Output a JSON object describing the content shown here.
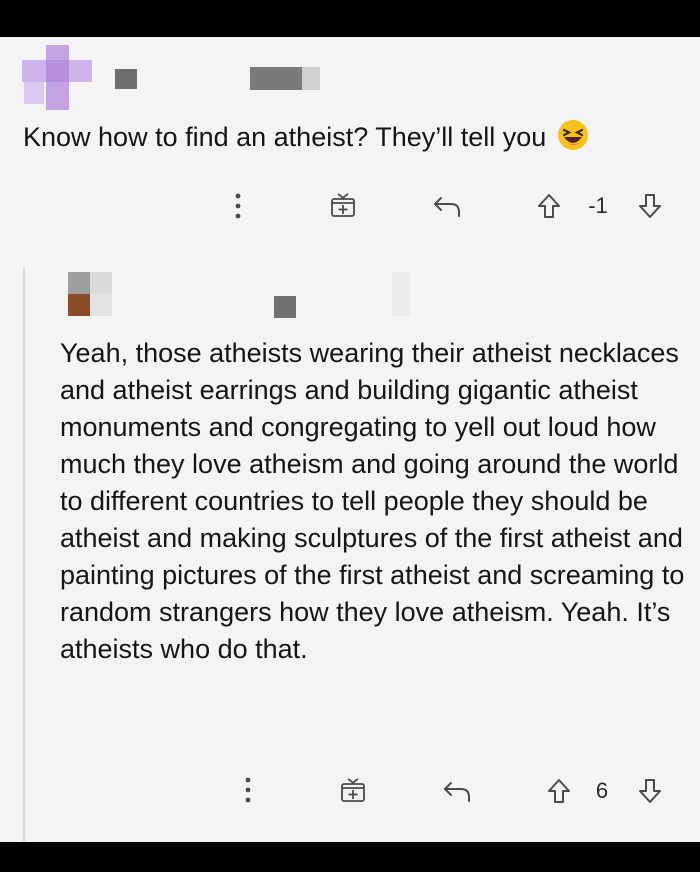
{
  "comment_1": {
    "text": "Know how to find an atheist? They’ll tell you",
    "emoji_icon": "laughing-face-icon",
    "actions": {
      "more_icon": "more-vertical-icon",
      "award_icon": "gift-icon",
      "reply_icon": "reply-arrow-icon",
      "upvote_icon": "arrow-up-icon",
      "vote_count": "-1",
      "downvote_icon": "arrow-down-icon"
    }
  },
  "comment_2": {
    "text": "Yeah, those atheists wearing their atheist necklaces and atheist earrings and building gigantic atheist monuments and congregating to yell out loud how much they love atheism and going around the world to different countries to tell people they should be atheist and making sculptures of the first atheist and painting pictures of the first atheist and screaming to random strangers how they love atheism. Yeah. It’s atheists who do that.",
    "actions": {
      "more_icon": "more-vertical-icon",
      "award_icon": "gift-icon",
      "reply_icon": "reply-arrow-icon",
      "upvote_icon": "arrow-up-icon",
      "vote_count": "6",
      "downvote_icon": "arrow-down-icon"
    }
  },
  "colors": {
    "background": "#f4f4f4",
    "text": "#151515",
    "icon": "#4a4a4a",
    "avatar_1": "#c9a6e4",
    "avatar_2_accent": "#8a4b2a"
  }
}
